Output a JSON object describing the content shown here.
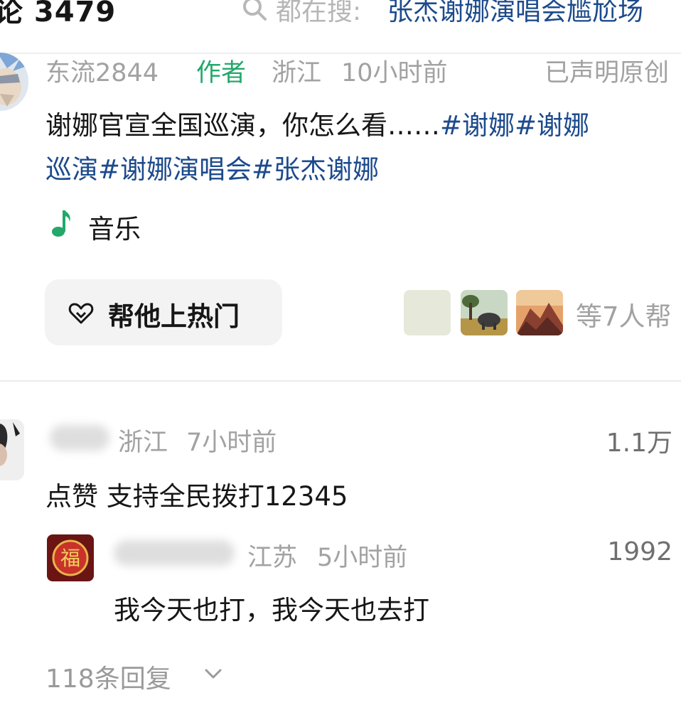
{
  "header": {
    "title": "论 3479",
    "search_prefix": "都在搜:",
    "search_term": "张杰谢娜演唱会尴尬场"
  },
  "post": {
    "author_name": "东流2844",
    "author_badge": "作者",
    "location": "浙江",
    "time": "10小时前",
    "original_label": "已声明原创",
    "text_line1_plain": "谢娜官宣全国巡演，你怎么看……",
    "text_line1_tags": "#谢娜#谢娜",
    "text_line2_tags": "巡演#谢娜演唱会#张杰谢娜",
    "music_label": "音乐",
    "hot_button_label": "帮他上热门",
    "helpers_label": "等7人帮",
    "colors": {
      "accent_green": "#23a86a",
      "hashtag_blue": "#1c4a8c"
    }
  },
  "comments": [
    {
      "name": "",
      "location": "浙江",
      "time": "7小时前",
      "likes": "1.1万",
      "text": "点赞 支持全民拨打12345",
      "reply": {
        "name": "",
        "location": "江苏",
        "time": "5小时前",
        "likes": "1992",
        "text": "我今天也打，我今天也去打",
        "avatar_char": "福"
      }
    }
  ],
  "replies_label": "118条回复",
  "icons": {
    "search": "search-icon",
    "music": "music-note-icon",
    "hot": "heart-hot-icon",
    "chevron": "chevron-down-icon"
  }
}
